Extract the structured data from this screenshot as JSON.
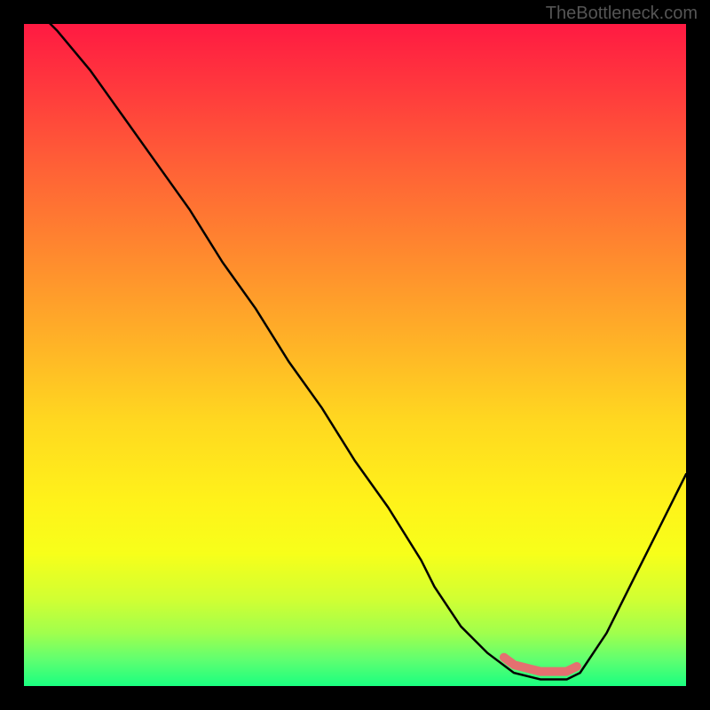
{
  "watermark": "TheBottleneck.com",
  "chart_data": {
    "type": "line",
    "title": "",
    "xlabel": "",
    "ylabel": "",
    "xlim": [
      0,
      100
    ],
    "ylim": [
      0,
      100
    ],
    "x": [
      0,
      5,
      10,
      15,
      20,
      25,
      30,
      35,
      40,
      45,
      50,
      55,
      60,
      62,
      66,
      70,
      74,
      78,
      82,
      84,
      88,
      92,
      96,
      100
    ],
    "values": [
      104,
      99,
      93,
      86,
      79,
      72,
      64,
      57,
      49,
      42,
      34,
      27,
      19,
      15,
      9,
      5,
      2,
      1,
      1,
      2,
      8,
      16,
      24,
      32
    ],
    "highlight_band": {
      "x_start": 72.5,
      "x_end": 83.5,
      "color": "#e47070"
    },
    "gradient_stops": [
      {
        "pos": 0,
        "color": "#ff1a42"
      },
      {
        "pos": 35,
        "color": "#ff8a2e"
      },
      {
        "pos": 72,
        "color": "#fff21a"
      },
      {
        "pos": 100,
        "color": "#1aff80"
      }
    ]
  }
}
